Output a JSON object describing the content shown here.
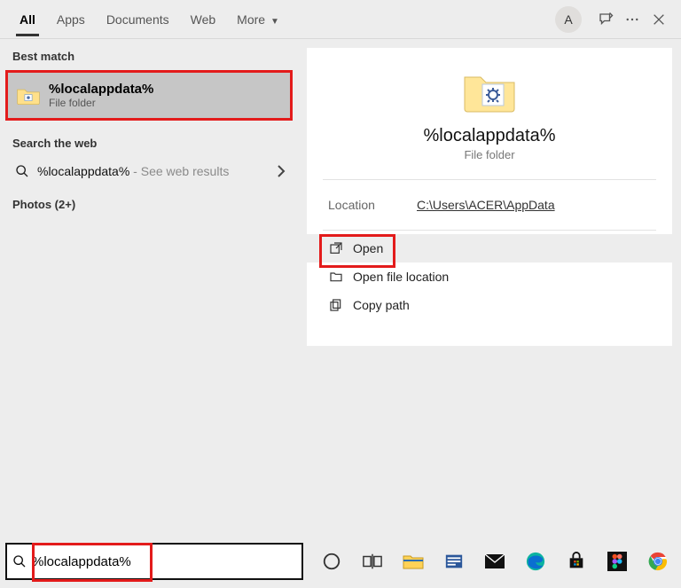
{
  "tabs": {
    "all": "All",
    "apps": "Apps",
    "documents": "Documents",
    "web": "Web",
    "more": "More"
  },
  "avatar_letter": "A",
  "left": {
    "best_match_label": "Best match",
    "result_title": "%localappdata%",
    "result_sub": "File folder",
    "search_web_label": "Search the web",
    "web_query": "%localappdata%",
    "web_suffix": " - See web results",
    "photos_label": "Photos (2+)"
  },
  "right": {
    "title": "%localappdata%",
    "sub": "File folder",
    "location_label": "Location",
    "location_value": "C:\\Users\\ACER\\AppData",
    "actions": {
      "open": "Open",
      "open_file_location": "Open file location",
      "copy_path": "Copy path"
    }
  },
  "search_value": "%localappdata%"
}
